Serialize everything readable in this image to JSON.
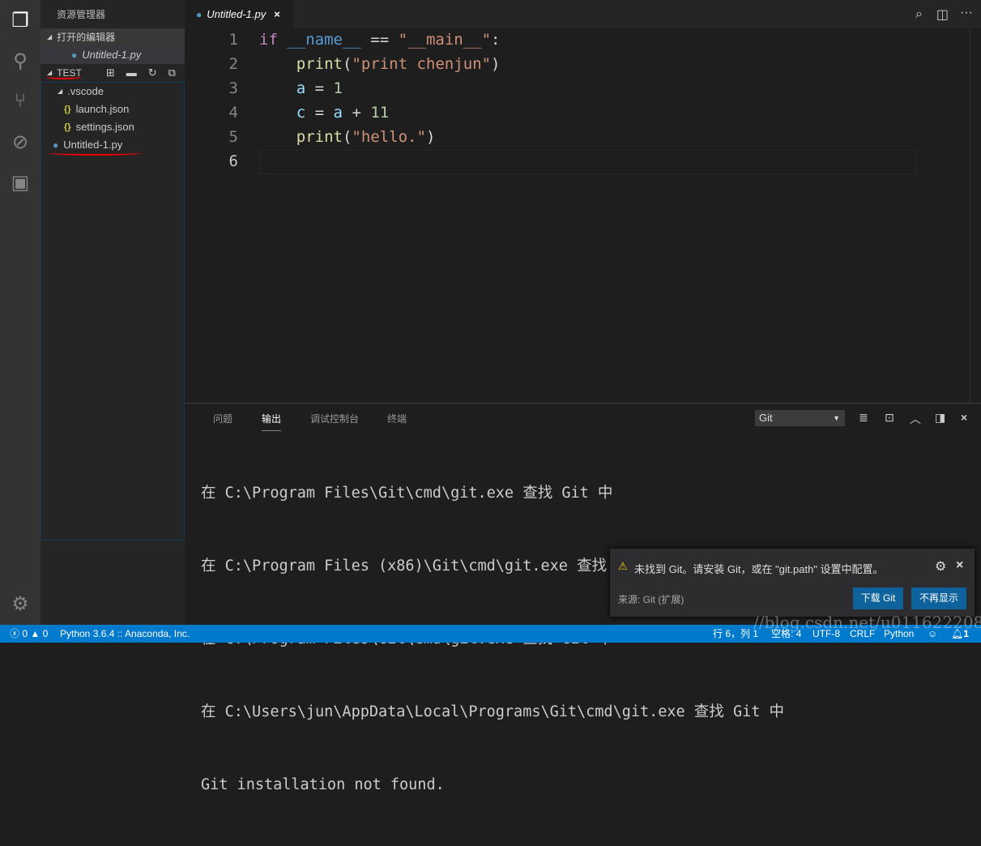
{
  "activity_bar": {
    "icons": [
      "files-icon",
      "search-icon",
      "source-control-icon",
      "debug-icon",
      "extensions-icon",
      "gear-icon"
    ]
  },
  "sidebar": {
    "title": "资源管理器",
    "open_editors_label": "打开的编辑器",
    "open_editors": [
      {
        "name": "Untitled-1.py"
      }
    ],
    "folder_label": "TEST",
    "tree": [
      {
        "name": ".vscode",
        "type": "folder"
      },
      {
        "name": "launch.json",
        "type": "json"
      },
      {
        "name": "settings.json",
        "type": "json"
      },
      {
        "name": "Untitled-1.py",
        "type": "python"
      }
    ]
  },
  "tab": {
    "label": "Untitled-1.py",
    "close": "×"
  },
  "editor": {
    "line_numbers": [
      "1",
      "2",
      "3",
      "4",
      "5",
      "6"
    ],
    "lines": [
      "if __name__ == \"__main__\":",
      "    print(\"print chenjun\")",
      "    a = 1",
      "    c = a + 11",
      "    print(\"hello.\")",
      ""
    ]
  },
  "panel": {
    "tabs": [
      "问题",
      "输出",
      "调试控制台",
      "终端"
    ],
    "active_tab": "输出",
    "channel": "Git",
    "output": [
      "在 C:\\Program Files\\Git\\cmd\\git.exe 查找 Git 中",
      "在 C:\\Program Files (x86)\\Git\\cmd\\git.exe 查找 Git 中",
      "在 C:\\Program Files\\Git\\cmd\\git.exe 查找 Git 中",
      "在 C:\\Users\\jun\\AppData\\Local\\Programs\\Git\\cmd\\git.exe 查找 Git 中",
      "Git installation not found."
    ]
  },
  "notification": {
    "message": "未找到 Git。请安装 Git，或在 \"git.path\" 设置中配置。",
    "source": "来源: Git (扩展)",
    "buttons": [
      "下载 Git",
      "不再显示"
    ]
  },
  "status": {
    "errors": "0",
    "warnings": "0",
    "interpreter": "Python 3.6.4 :: Anaconda, Inc.",
    "position": "行 6，列 1",
    "spaces": "空格: 4",
    "encoding": "UTF-8",
    "eol": "CRLF",
    "language": "Python",
    "notifications": "1",
    "watermark": "//blog.csdn.net/u011622208"
  },
  "colors": {
    "status_bar": "#007acc",
    "activity_bar": "#333333",
    "sidebar": "#252526",
    "editor": "#1e1e1e",
    "button": "#0e639c"
  }
}
